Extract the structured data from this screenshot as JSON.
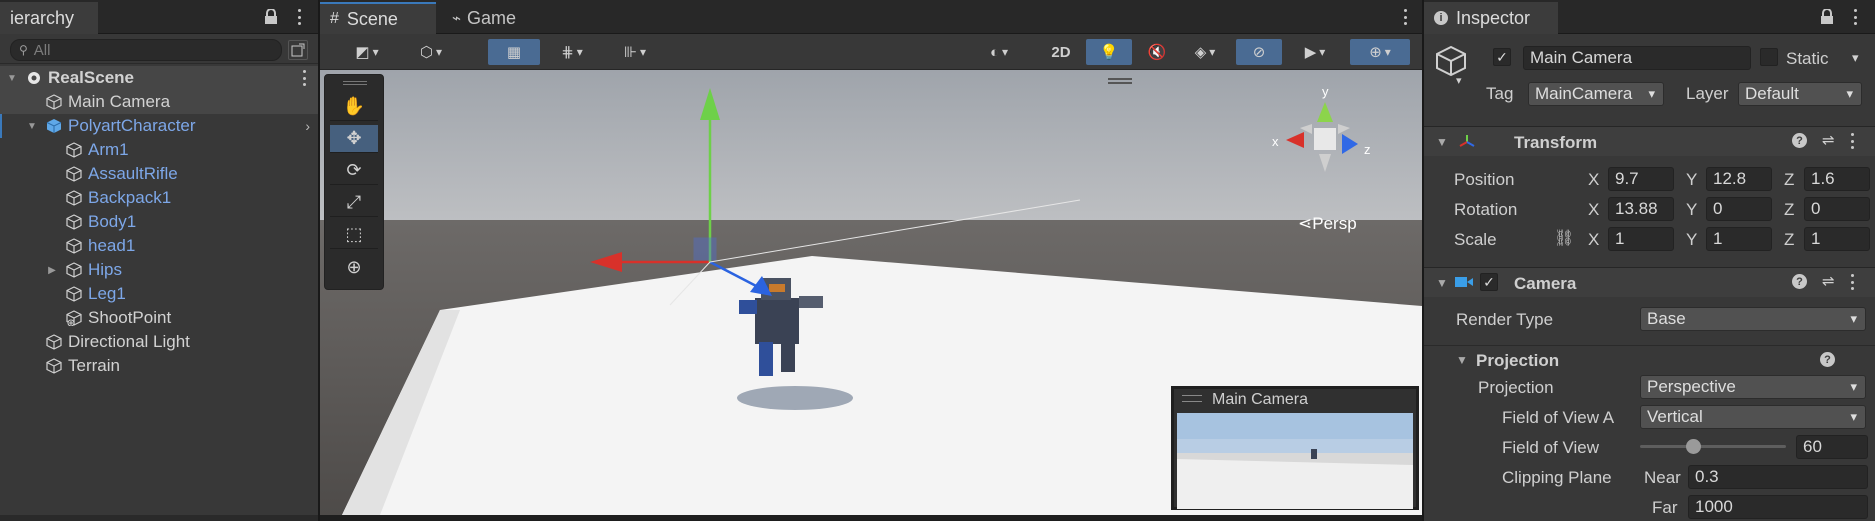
{
  "hierarchy": {
    "tab_label": "ierarchy",
    "search_placeholder": "All",
    "items": [
      {
        "label": "RealScene"
      },
      {
        "label": "Main Camera"
      },
      {
        "label": "PolyartCharacter"
      },
      {
        "label": "Arm1"
      },
      {
        "label": "AssaultRifle"
      },
      {
        "label": "Backpack1"
      },
      {
        "label": "Body1"
      },
      {
        "label": "head1"
      },
      {
        "label": "Hips"
      },
      {
        "label": "Leg1"
      },
      {
        "label": "ShootPoint"
      },
      {
        "label": "Directional Light"
      },
      {
        "label": "Terrain"
      }
    ]
  },
  "scene": {
    "tab_scene": "Scene",
    "tab_game": "Game",
    "btn_2d": "2D",
    "persp_label": "Persp",
    "gizmo_x": "x",
    "gizmo_y": "y",
    "gizmo_z": "z",
    "camera_preview_title": "Main Camera"
  },
  "inspector": {
    "tab_label": "Inspector",
    "object_name": "Main Camera",
    "static_label": "Static",
    "tag_label": "Tag",
    "tag_value": "MainCamera",
    "layer_label": "Layer",
    "layer_value": "Default",
    "transform": {
      "title": "Transform",
      "position_label": "Position",
      "rotation_label": "Rotation",
      "scale_label": "Scale",
      "axis_x": "X",
      "axis_y": "Y",
      "axis_z": "Z",
      "position": [
        "9.7",
        "12.8",
        "1.6"
      ],
      "rotation": [
        "13.88",
        "0",
        "0"
      ],
      "scale": [
        "1",
        "1",
        "1"
      ]
    },
    "camera": {
      "title": "Camera",
      "render_type_label": "Render Type",
      "render_type_value": "Base",
      "projection_header": "Projection",
      "projection_label": "Projection",
      "projection_value": "Perspective",
      "fov_axis_label": "Field of View A",
      "fov_axis_value": "Vertical",
      "fov_label": "Field of View",
      "fov_value": "60",
      "fov_slider_fraction": 0.35,
      "clip_label": "Clipping Plane",
      "near_label": "Near",
      "near_value": "0.3",
      "far_label": "Far",
      "far_value": "1000"
    }
  },
  "colors": {
    "selection_blue": "#3a79bb",
    "prefab_blue": "#7da7e8",
    "panel": "#383838"
  }
}
